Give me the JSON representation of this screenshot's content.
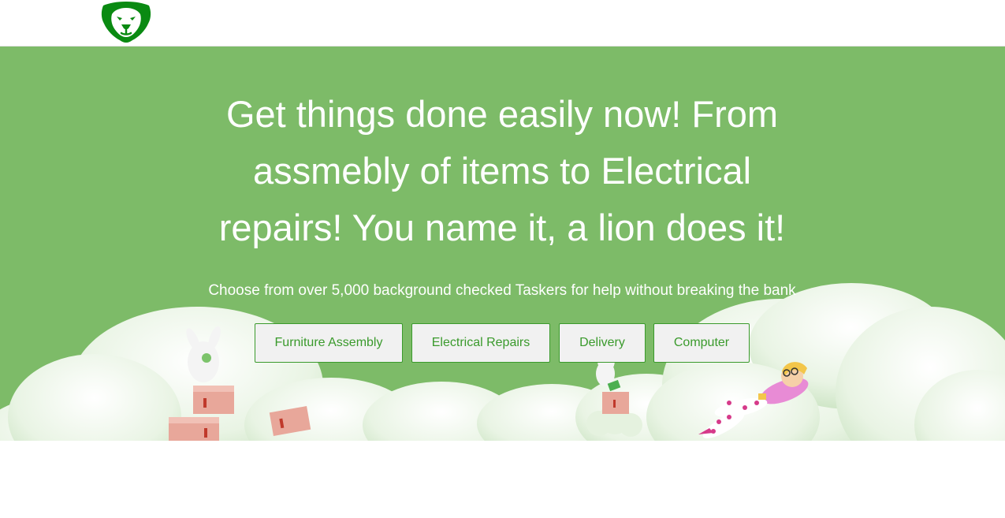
{
  "header": {
    "logo": {
      "icon": "lion-head-icon",
      "color": "#0a8a12"
    }
  },
  "hero": {
    "background_color": "#7dbb68",
    "headline": "Get things done easily now! From assmebly of items to Electrical repairs! You name it, a lion does it!",
    "subline": "Choose from over 5,000 background checked Taskers for help without breaking the bank",
    "categories": [
      {
        "label": "Furniture Assembly"
      },
      {
        "label": "Electrical Repairs"
      },
      {
        "label": "Delivery"
      },
      {
        "label": "Computer"
      }
    ],
    "illustration": "clouds-with-boxes-and-relaxing-person"
  },
  "colors": {
    "accent": "#3a9a2c",
    "button_background": "#f1f1f1"
  }
}
